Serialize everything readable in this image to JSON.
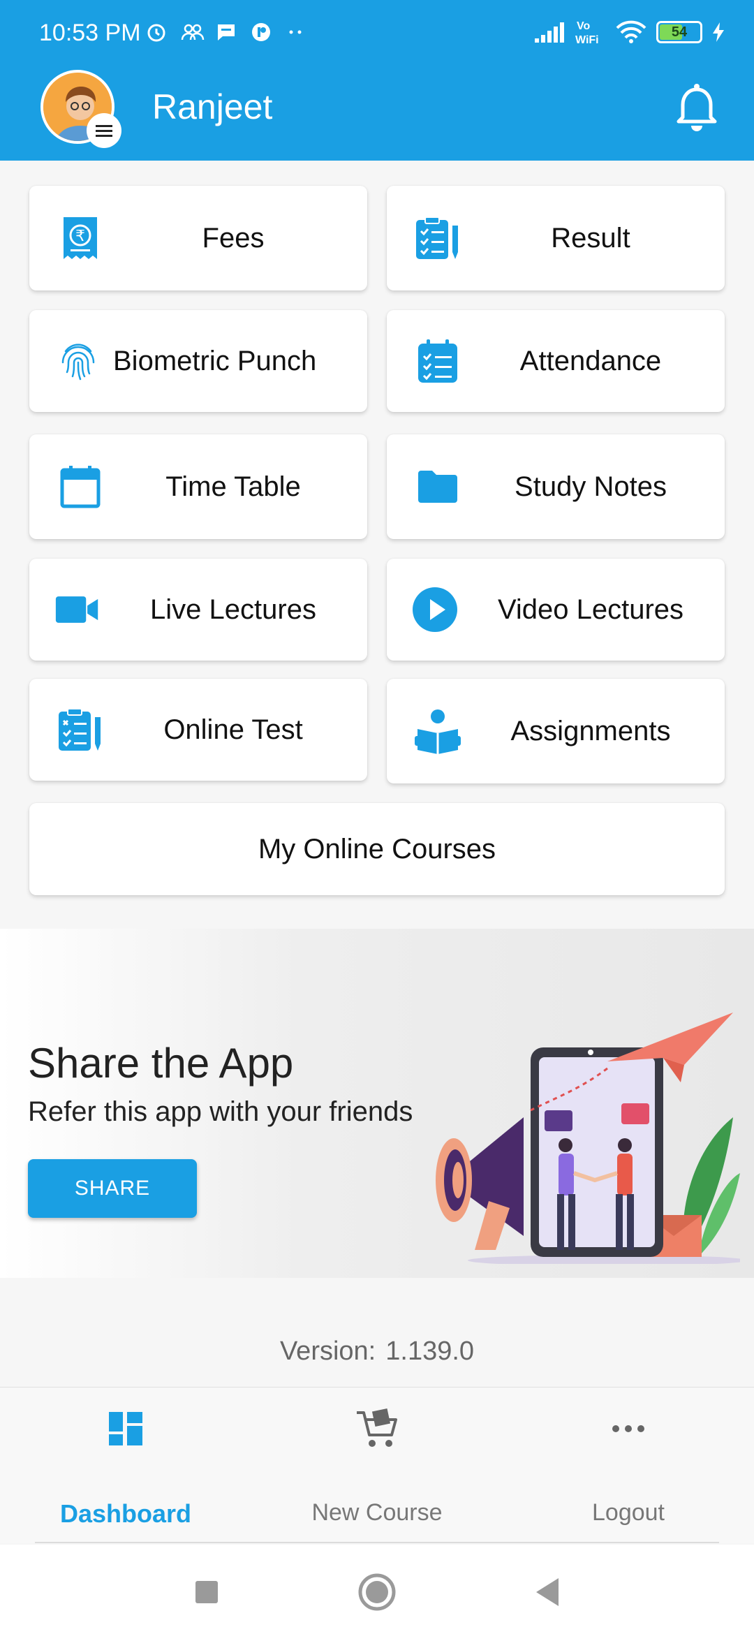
{
  "status_bar": {
    "time": "10:53 PM",
    "battery": "54",
    "network": "Vo WiFi",
    "icons_left": [
      "alarm-icon",
      "group-icon",
      "chat-icon",
      "app-icon",
      "more-dots-icon"
    ],
    "icons_right": [
      "signal-icon",
      "vowifi-icon",
      "wifi-icon",
      "battery-icon",
      "charging-icon"
    ]
  },
  "header": {
    "username": "Ranjeet",
    "accent_color": "#1a9fe3"
  },
  "menu": {
    "fees": "Fees",
    "result": "Result",
    "biometric": "Biometric Punch",
    "attendance": "Attendance",
    "timetable": "Time Table",
    "studynotes": "Study Notes",
    "livelectures": "Live Lectures",
    "videolectures": "Video Lectures",
    "onlinetest": "Online Test",
    "assignments": "Assignments",
    "mycourses": "My Online Courses"
  },
  "banner": {
    "title": "Share the App",
    "subtitle": "Refer this app with your friends",
    "button": "SHARE"
  },
  "version": {
    "label": "Version:",
    "number": "1.139.0"
  },
  "bottom_nav": {
    "dashboard": "Dashboard",
    "new_course": "New Course",
    "logout": "Logout"
  }
}
